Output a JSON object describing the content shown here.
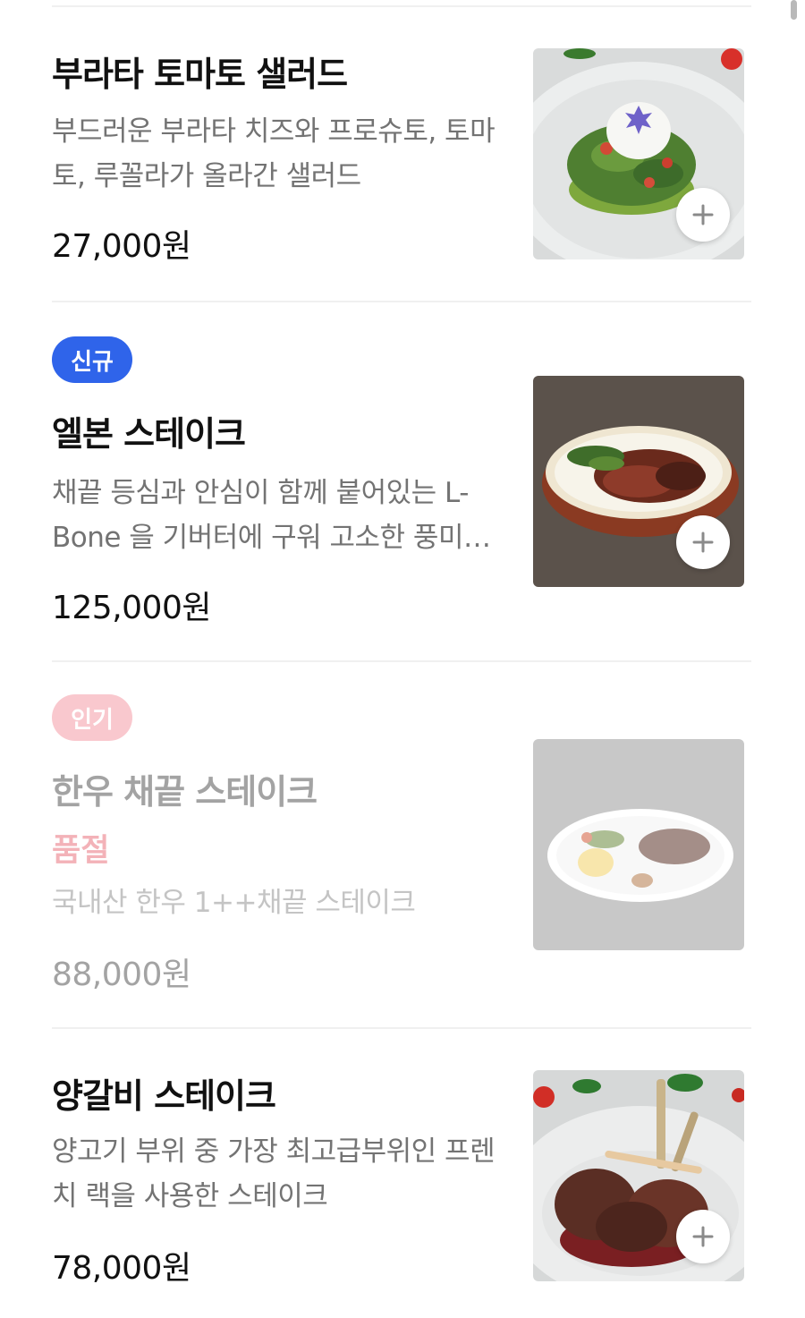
{
  "menu": {
    "items": [
      {
        "title": "부라타 토마토 샐러드",
        "description": "부드러운 부라타 치즈와 프로슈토, 토마토, 루꼴라가 올라간 샐러드",
        "price": "27,000원",
        "add_icon": "plus-icon"
      },
      {
        "badge": "신규",
        "title": "엘본 스테이크",
        "description": "채끝 등심과 안심이 함께 붙어있는 L-Bone 을 기버터에 구워 고소한 풍미…",
        "price": "125,000원",
        "add_icon": "plus-icon"
      },
      {
        "badge": "인기",
        "title": "한우 채끝 스테이크",
        "status": "품절",
        "description": "국내산 한우 1++채끝 스테이크",
        "price": "88,000원"
      },
      {
        "title": "양갈비 스테이크",
        "description": "양고기 부위 중 가장 최고급부위인 프렌치 랙을 사용한 스테이크",
        "price": "78,000원",
        "add_icon": "plus-icon"
      }
    ]
  },
  "colors": {
    "badge_new": "#2f64ea",
    "badge_popular": "#f9c8ce",
    "soldout_text": "#f3b2b8"
  }
}
